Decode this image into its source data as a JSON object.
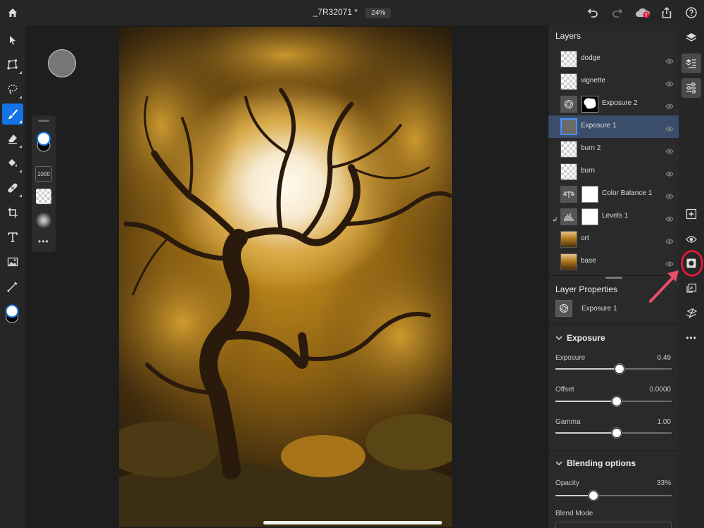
{
  "header": {
    "doc_title": "_7R32071 *",
    "zoom": "24%",
    "icons": [
      "home-icon",
      "undo-icon",
      "redo-icon",
      "cloud-sync-icon",
      "share-icon",
      "help-icon"
    ]
  },
  "left_toolbar": {
    "tools": [
      "select-icon",
      "transform-icon",
      "lasso-icon",
      "brush-icon",
      "eraser-icon",
      "fill-icon",
      "healing-icon",
      "crop-icon",
      "type-icon",
      "place-image-icon",
      "eyedropper-icon",
      "color-swatch-icon"
    ],
    "active_tool": "brush-icon"
  },
  "tool_options": {
    "brush_size": "1000"
  },
  "layers_panel": {
    "title": "Layers",
    "layers": [
      {
        "name": "dodge"
      },
      {
        "name": "vignette"
      },
      {
        "name": "Exposure 2"
      },
      {
        "name": "Exposure 1"
      },
      {
        "name": "burn 2"
      },
      {
        "name": "burn"
      },
      {
        "name": "Color Balance 1"
      },
      {
        "name": "Levels 1"
      },
      {
        "name": "ort"
      },
      {
        "name": "base"
      }
    ],
    "selected": "Exposure 1"
  },
  "layer_properties": {
    "title": "Layer Properties",
    "layer_name": "Exposure 1"
  },
  "exposure_section": {
    "title": "Exposure",
    "exposure_label": "Exposure",
    "exposure_value": "0.49",
    "exposure_fraction": 0.55,
    "offset_label": "Offset",
    "offset_value": "0.0000",
    "offset_fraction": 0.53,
    "gamma_label": "Gamma",
    "gamma_value": "1.00",
    "gamma_fraction": 0.53
  },
  "blending_section": {
    "title": "Blending options",
    "opacity_label": "Opacity",
    "opacity_value": "33%",
    "opacity_fraction": 0.33,
    "blend_mode_label": "Blend Mode"
  },
  "right_toolbar": {
    "buttons": [
      "layers-stack-icon",
      "layer-properties-icon",
      "adjustments-icon",
      "add-layer-icon",
      "visibility-icon",
      "add-mask-icon",
      "clip-icon",
      "merge-icon",
      "more-icon"
    ],
    "highlighted": "add-mask-icon",
    "highlight_color": "#e0193a"
  },
  "colors": {
    "accent": "#1473e6",
    "selected_row": "#3a4d6a",
    "panel_bg": "#2a2a2a"
  }
}
